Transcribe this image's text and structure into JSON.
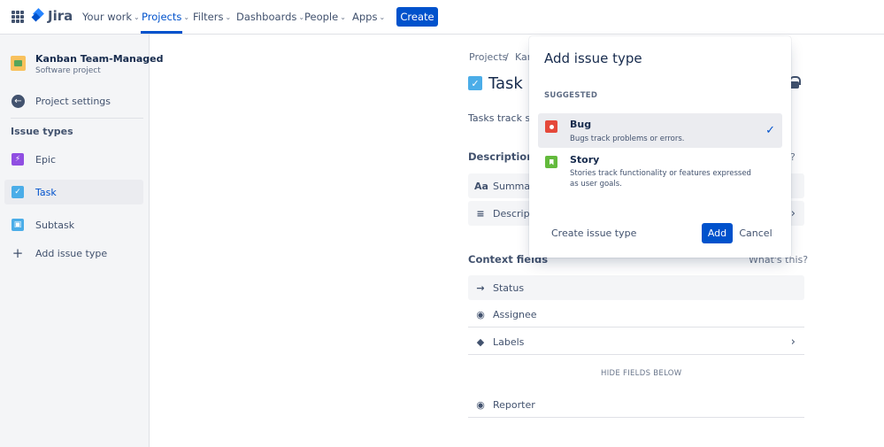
{
  "nav": {
    "logo": "Jira",
    "items": [
      {
        "label": "Your work"
      },
      {
        "label": "Projects"
      },
      {
        "label": "Filters"
      },
      {
        "label": "Dashboards"
      },
      {
        "label": "People"
      },
      {
        "label": "Apps"
      }
    ],
    "create": "Create"
  },
  "sidebar": {
    "project_name": "Kanban Team-Managed",
    "project_type": "Software project",
    "project_settings": "Project settings",
    "issue_types_heading": "Issue types",
    "items": [
      {
        "label": "Epic",
        "icon": "epic-icon"
      },
      {
        "label": "Task",
        "icon": "task-icon",
        "selected": true
      },
      {
        "label": "Subtask",
        "icon": "subtask-icon"
      }
    ],
    "add_issue_type": "Add issue type"
  },
  "main": {
    "breadcrumb": [
      "Projects",
      "/",
      "Kan"
    ],
    "title": "Task",
    "description": "Tasks track sma",
    "description_fields_heading": "Description fie",
    "description_fields": [
      {
        "label": "Summary",
        "icon": "Aa"
      },
      {
        "label": "Descriptio",
        "icon": "≡"
      }
    ],
    "whats_this_1": "?",
    "context_fields_heading": "Context fields",
    "whats_this_2": "What's this?",
    "context_fields": [
      {
        "label": "Status"
      },
      {
        "label": "Assignee"
      },
      {
        "label": "Labels"
      }
    ],
    "hide_fields": "HIDE FIELDS BELOW",
    "hidden_fields": [
      {
        "label": "Reporter"
      }
    ]
  },
  "modal": {
    "title": "Add issue type",
    "section": "SUGGESTED",
    "options": [
      {
        "name": "Bug",
        "desc": "Bugs track problems or errors.",
        "selected": true
      },
      {
        "name": "Story",
        "desc": "Stories track functionality or features expressed as user goals.",
        "selected": false
      }
    ],
    "create_link": "Create issue type",
    "add": "Add",
    "cancel": "Cancel"
  },
  "colors": {
    "primary": "#0052cc",
    "task": "#4bade8",
    "epic": "#904ee2",
    "bug": "#e5493a",
    "story": "#63ba3c"
  }
}
